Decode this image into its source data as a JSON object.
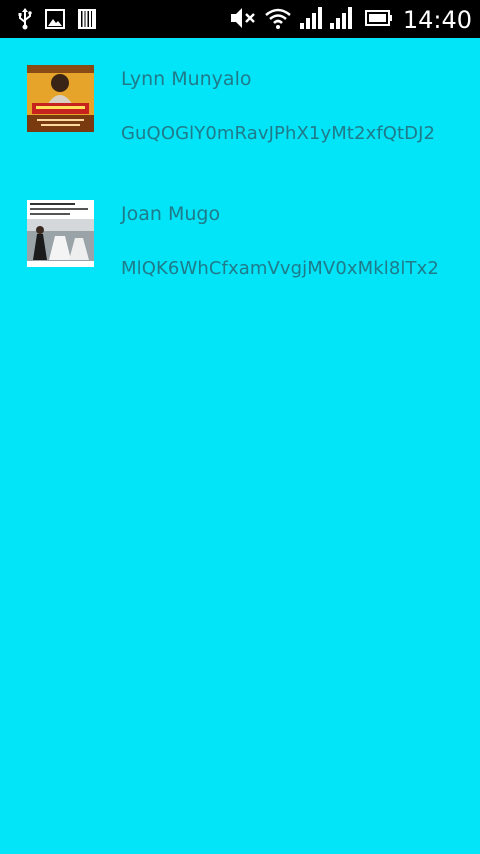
{
  "status_bar": {
    "time": "14:40",
    "icons": [
      "usb-icon",
      "image-icon",
      "barcode-icon",
      "mute-icon",
      "wifi-icon",
      "signal-icon",
      "signal-icon-2",
      "battery-icon"
    ]
  },
  "contacts": [
    {
      "name": "Lynn Munyalo",
      "token": "GuQOGlY0mRavJPhX1yMt2xfQtDJ2",
      "thumbnail": "flyer-thumbnail"
    },
    {
      "name": "Joan Mugo",
      "token": "MlQK6WhCfxamVvgjMV0xMkl8lTx2",
      "thumbnail": "wedding-photo-thumbnail"
    }
  ],
  "colors": {
    "background": "#02e4f8",
    "text": "#1f7b8a",
    "status_bar": "#000000"
  }
}
